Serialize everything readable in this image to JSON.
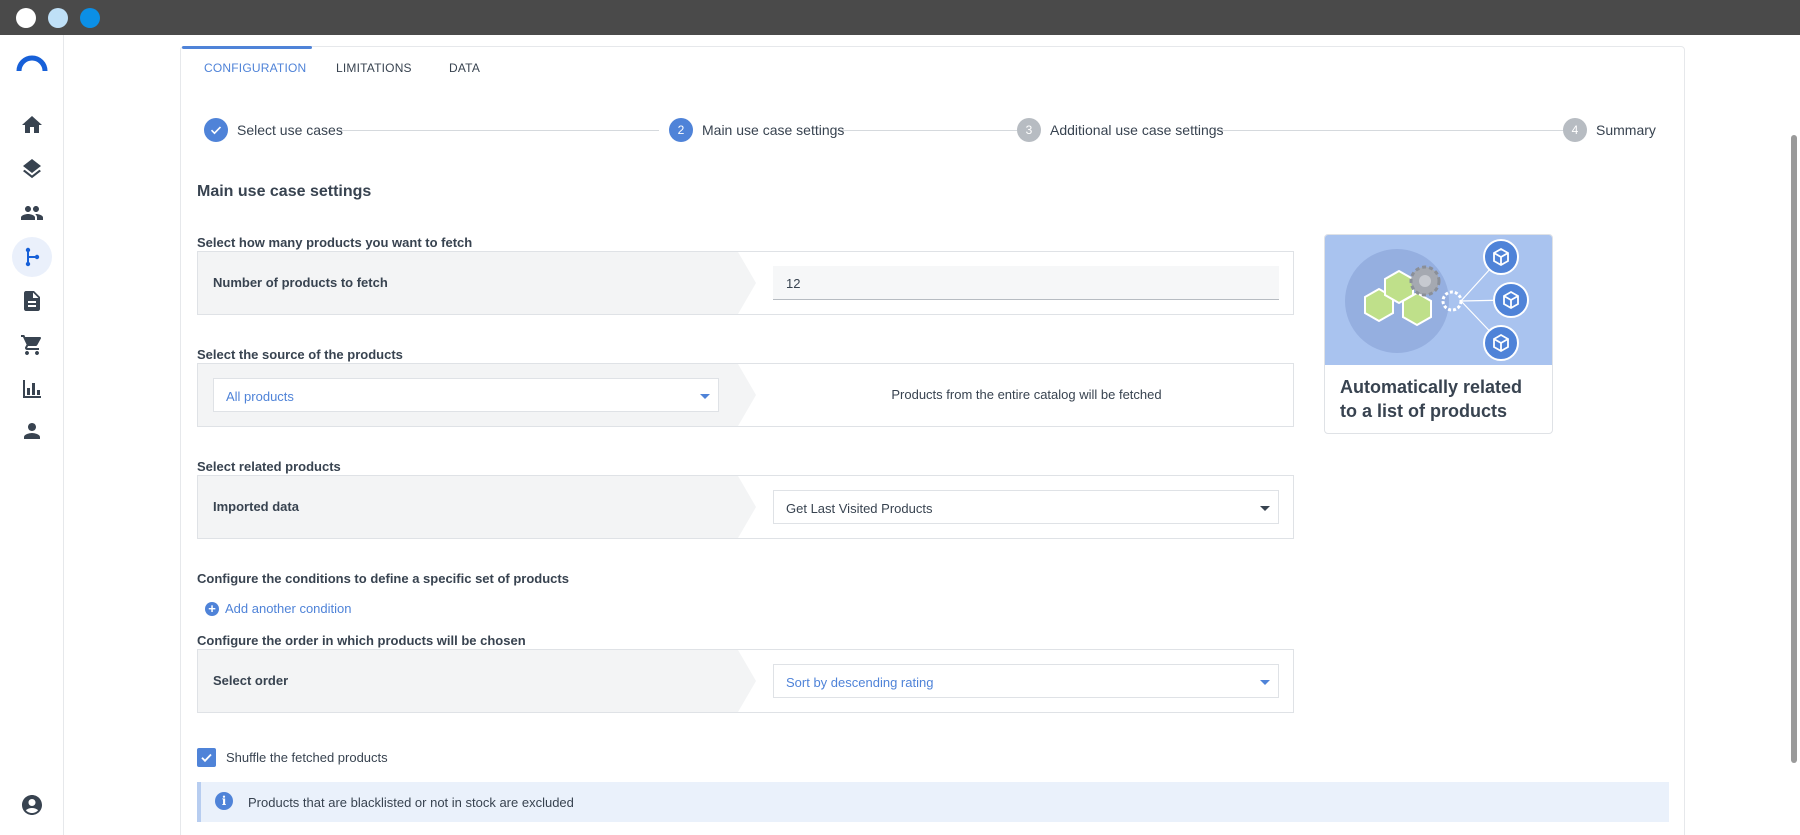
{
  "tabs": [
    {
      "label": "CONFIGURATION",
      "active": true
    },
    {
      "label": "LIMITATIONS",
      "active": false
    },
    {
      "label": "DATA",
      "active": false
    }
  ],
  "stepper": [
    {
      "marker": "✓",
      "label": "Select use cases",
      "state": "done"
    },
    {
      "marker": "2",
      "label": "Main use case settings",
      "state": "current"
    },
    {
      "marker": "3",
      "label": "Additional use case settings",
      "state": "pending"
    },
    {
      "marker": "4",
      "label": "Summary",
      "state": "pending"
    }
  ],
  "page_title": "Main use case settings",
  "fetch": {
    "section_label": "Select how many products you want to fetch",
    "row_label": "Number of products to fetch",
    "value": "12"
  },
  "source": {
    "section_label": "Select the source of the products",
    "selected": "All products",
    "note": "Products from the entire catalog will be fetched"
  },
  "related": {
    "section_label": "Select related products",
    "row_label": "Imported data",
    "selected": "Get Last Visited Products"
  },
  "conditions": {
    "section_label": "Configure the conditions to define a specific set of products",
    "add_label": "Add another condition"
  },
  "order": {
    "section_label": "Configure the order in which products will be chosen",
    "row_label": "Select order",
    "selected": "Sort by descending rating"
  },
  "shuffle": {
    "label": "Shuffle the fetched products",
    "checked": true
  },
  "info_banner": "Products that are blacklisted or not in stock are excluded",
  "illustration": {
    "title": "Automatically related to a list of products"
  },
  "sidebar": {
    "items": [
      "home-icon",
      "layers-icon",
      "people-icon",
      "branch-icon",
      "document-icon",
      "cart-icon",
      "chart-icon",
      "person-icon"
    ],
    "active": "branch-icon",
    "footer": "account-icon"
  },
  "colors": {
    "accent": "#4f83d8",
    "titlebar": "#4a4a4a",
    "panel": "#f3f4f5"
  }
}
